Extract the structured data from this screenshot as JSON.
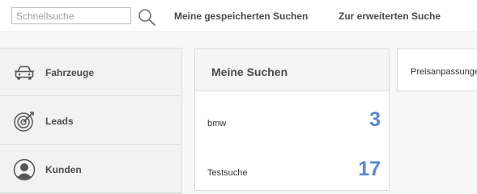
{
  "topbar": {
    "search": {
      "placeholder": "Schnellsuche",
      "value": ""
    },
    "links": [
      "Meine gespeicherten Suchen",
      "Zur erweiterten Suche"
    ]
  },
  "sidebar": {
    "items": [
      {
        "label": "Fahrzeuge",
        "icon": "car-icon"
      },
      {
        "label": "Leads",
        "icon": "target-icon"
      },
      {
        "label": "Kunden",
        "icon": "user-icon"
      }
    ]
  },
  "widgets": [
    {
      "title": "Meine Suchen",
      "rows": [
        {
          "name": "bmw",
          "count": "3"
        },
        {
          "name": "Testsuche",
          "count": "17"
        }
      ]
    },
    {
      "title": "Preisanpassungen"
    }
  ],
  "colors": {
    "accent": "#5a86d6",
    "sidebar_bg": "#f2f2f2",
    "control_bg": "#c9c9c9"
  }
}
